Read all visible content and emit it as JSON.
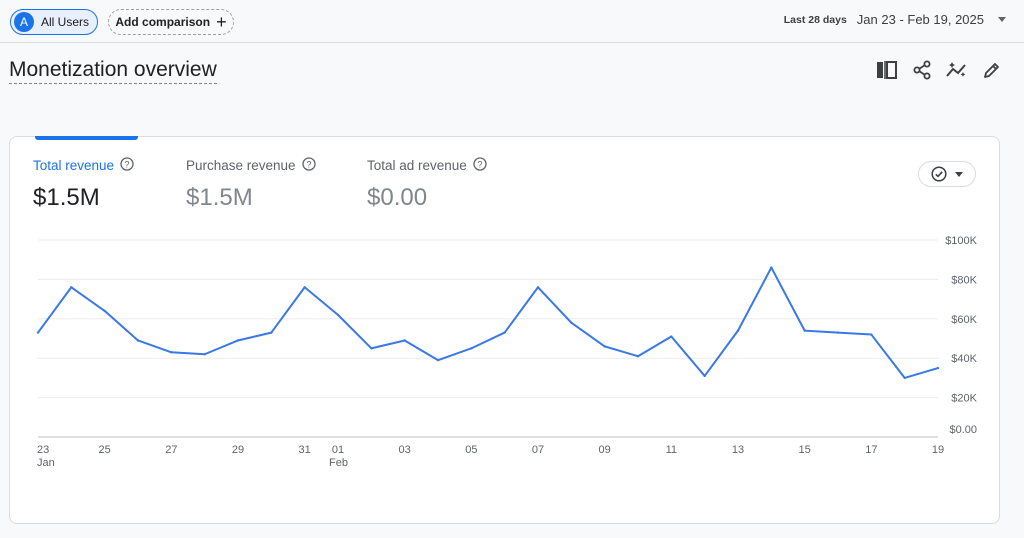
{
  "header": {
    "segment_initial": "A",
    "segment_label": "All Users",
    "add_comparison_label": "Add comparison",
    "date_preset": "Last 28 days",
    "date_range": "Jan 23 - Feb 19, 2025"
  },
  "page": {
    "title": "Monetization overview"
  },
  "toolbar": {
    "icons": [
      "compare-columns-icon",
      "share-icon",
      "insights-icon",
      "edit-pencil-icon"
    ]
  },
  "card": {
    "metrics": [
      {
        "label": "Total revenue",
        "value": "$1.5M",
        "active": true
      },
      {
        "label": "Purchase revenue",
        "value": "$1.5M",
        "active": false
      },
      {
        "label": "Total ad revenue",
        "value": "$0.00",
        "active": false
      }
    ]
  },
  "chart_data": {
    "type": "line",
    "line_color": "#3b78e7",
    "x": [
      "Jan 23",
      "Jan 24",
      "Jan 25",
      "Jan 26",
      "Jan 27",
      "Jan 28",
      "Jan 29",
      "Jan 30",
      "Jan 31",
      "Feb 01",
      "Feb 02",
      "Feb 03",
      "Feb 04",
      "Feb 05",
      "Feb 06",
      "Feb 07",
      "Feb 08",
      "Feb 09",
      "Feb 10",
      "Feb 11",
      "Feb 12",
      "Feb 13",
      "Feb 14",
      "Feb 15",
      "Feb 16",
      "Feb 17",
      "Feb 18",
      "Feb 19"
    ],
    "series": [
      {
        "values": [
          53000,
          76000,
          64000,
          49000,
          43000,
          42000,
          49000,
          53000,
          76000,
          62000,
          45000,
          49000,
          39000,
          45000,
          53000,
          76000,
          58000,
          46000,
          41000,
          51000,
          31000,
          54000,
          86000,
          54000,
          53000,
          52000,
          30000,
          35000
        ]
      }
    ],
    "ylim": [
      0,
      100000
    ],
    "y_ticks": [
      0,
      20000,
      40000,
      60000,
      80000,
      100000
    ],
    "y_tick_labels": [
      "$0.00",
      "$20K",
      "$40K",
      "$60K",
      "$80K",
      "$100K"
    ],
    "x_tick_labels": [
      {
        "top": "23",
        "bottom": "Jan"
      },
      {
        "top": "25",
        "bottom": ""
      },
      {
        "top": "27",
        "bottom": ""
      },
      {
        "top": "29",
        "bottom": ""
      },
      {
        "top": "31",
        "bottom": ""
      },
      {
        "top": "01",
        "bottom": "Feb"
      },
      {
        "top": "03",
        "bottom": ""
      },
      {
        "top": "05",
        "bottom": ""
      },
      {
        "top": "07",
        "bottom": ""
      },
      {
        "top": "09",
        "bottom": ""
      },
      {
        "top": "11",
        "bottom": ""
      },
      {
        "top": "13",
        "bottom": ""
      },
      {
        "top": "15",
        "bottom": ""
      },
      {
        "top": "17",
        "bottom": ""
      },
      {
        "top": "19",
        "bottom": ""
      }
    ],
    "x_tick_indices": [
      0,
      2,
      4,
      6,
      8,
      9,
      11,
      13,
      15,
      17,
      19,
      21,
      23,
      25,
      27
    ],
    "grid": true,
    "y_axis_position": "right"
  }
}
